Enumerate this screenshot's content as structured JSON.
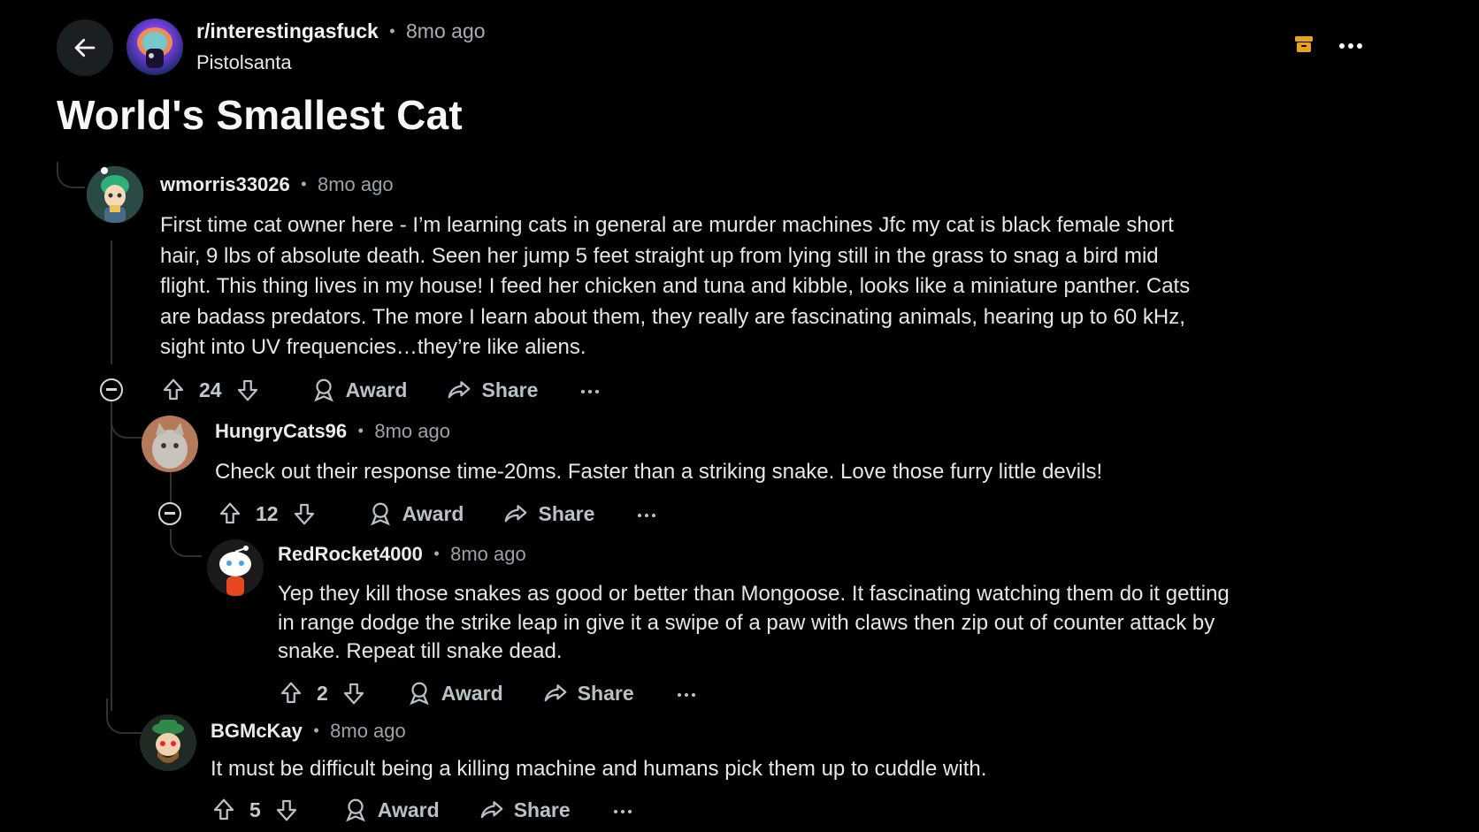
{
  "header": {
    "subreddit": "r/interestingasfuck",
    "time": "8mo ago",
    "author": "Pistolsanta",
    "separator": "•"
  },
  "post": {
    "title": "World's Smallest Cat"
  },
  "comments": [
    {
      "username": "wmorris33026",
      "time": "8mo ago",
      "body": "First time cat owner here - I’m learning cats in general are murder machines Jfc my cat is black female short hair, 9 lbs of absolute death. Seen her jump 5 feet straight up from lying still in the grass to snag a bird mid flight. This thing lives in my house! I feed her chicken and tuna and kibble, looks like a miniature panther. Cats are badass predators. The more I learn about them, they really are fascinating animals, hearing up to 60 kHz, sight into UV frequencies…they’re like aliens.",
      "votes": "24",
      "award_label": "Award",
      "share_label": "Share"
    },
    {
      "username": "HungryCats96",
      "time": "8mo ago",
      "body": "Check out their response time-20ms. Faster than a striking snake. Love those furry little devils!",
      "votes": "12",
      "award_label": "Award",
      "share_label": "Share"
    },
    {
      "username": "RedRocket4000",
      "time": "8mo ago",
      "body": "Yep they kill those snakes as good or better than Mongoose. It fascinating watching them do it getting in range dodge the strike leap in give it a swipe of a paw with claws then zip out of counter attack by snake. Repeat till snake dead.",
      "votes": "2",
      "award_label": "Award",
      "share_label": "Share"
    },
    {
      "username": "BGMcKay",
      "time": "8mo ago",
      "body": "It must be difficult being a killing machine and humans pick them up to cuddle with.",
      "votes": "5",
      "award_label": "Award",
      "share_label": "Share"
    }
  ],
  "icons": {
    "back": "back-arrow-icon",
    "save": "archive-icon",
    "more": "more-horizontal-icon",
    "upvote": "upvote-icon",
    "downvote": "downvote-icon",
    "award": "award-icon",
    "share": "share-icon",
    "collapse": "collapse-icon"
  },
  "colors": {
    "background": "#000000",
    "accent_save": "#e8a416",
    "text": "#e7ebee",
    "muted": "#a6afb5"
  }
}
